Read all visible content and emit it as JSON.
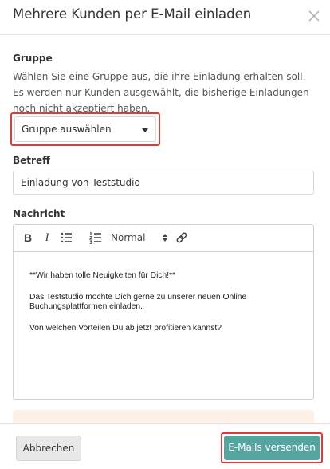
{
  "modal": {
    "title": "Mehrere Kunden per E-Mail einladen",
    "close_icon": "close-icon"
  },
  "group": {
    "label": "Gruppe",
    "help": "Wählen Sie eine Gruppe aus, die ihre Einladung erhalten soll. Es werden nur Kunden ausgewählt, die bisherige Einladungen noch nicht akzeptiert haben.",
    "select_value": "Gruppe auswählen"
  },
  "subject": {
    "label": "Betreff",
    "value": "Einladung von Teststudio"
  },
  "message": {
    "label": "Nachricht",
    "toolbar": {
      "bold_label": "B",
      "italic_label": "I",
      "bullet_list_icon": "bullet-list-icon",
      "ordered_list_icon": "ordered-list-icon",
      "header_value": "Normal",
      "link_icon": "link-icon"
    },
    "paragraphs": [
      "**Wir haben tolle Neuigkeiten für Dich!**",
      "Das Teststudio möchte Dich gerne zu unserer neuen Online Buchungsplattformen einladen.",
      "Von welchen Vorteilen Du ab jetzt profitieren kannst?"
    ]
  },
  "footer": {
    "cancel_label": "Abbrechen",
    "send_label": "E-Mails versenden"
  },
  "colors": {
    "primary": "#56a4a0",
    "highlight": "#e53935",
    "notice_bg": "#fdf0e6"
  }
}
